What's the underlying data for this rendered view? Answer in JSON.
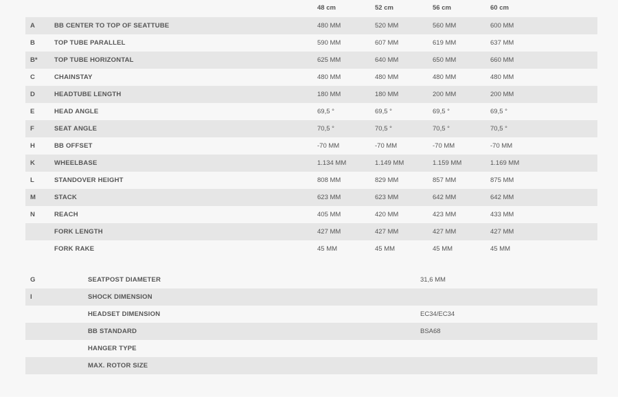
{
  "geometry": {
    "sizes": [
      "48 cm",
      "52 cm",
      "56 cm",
      "60 cm"
    ],
    "rows": [
      {
        "key": "A",
        "name": "BB CENTER TO TOP OF SEATTUBE",
        "values": [
          "480 MM",
          "520 MM",
          "560 MM",
          "600 MM"
        ]
      },
      {
        "key": "B",
        "name": "TOP TUBE PARALLEL",
        "values": [
          "590 MM",
          "607 MM",
          "619 MM",
          "637 MM"
        ]
      },
      {
        "key": "B*",
        "name": "TOP TUBE HORIZONTAL",
        "values": [
          "625 MM",
          "640 MM",
          "650 MM",
          "660 MM"
        ]
      },
      {
        "key": "C",
        "name": "CHAINSTAY",
        "values": [
          "480 MM",
          "480 MM",
          "480 MM",
          "480 MM"
        ]
      },
      {
        "key": "D",
        "name": "HEADTUBE LENGTH",
        "values": [
          "180 MM",
          "180 MM",
          "200 MM",
          "200 MM"
        ]
      },
      {
        "key": "E",
        "name": "HEAD ANGLE",
        "values": [
          "69,5 °",
          "69,5 °",
          "69,5 °",
          "69,5 °"
        ]
      },
      {
        "key": "F",
        "name": "SEAT ANGLE",
        "values": [
          "70,5 °",
          "70,5 °",
          "70,5 °",
          "70,5 °"
        ]
      },
      {
        "key": "H",
        "name": "BB OFFSET",
        "values": [
          "-70 MM",
          "-70 MM",
          "-70 MM",
          "-70 MM"
        ]
      },
      {
        "key": "K",
        "name": "WHEELBASE",
        "values": [
          "1.134 MM",
          "1.149 MM",
          "1.159 MM",
          "1.169 MM"
        ]
      },
      {
        "key": "L",
        "name": "STANDOVER HEIGHT",
        "values": [
          "808 MM",
          "829 MM",
          "857 MM",
          "875 MM"
        ]
      },
      {
        "key": "M",
        "name": "STACK",
        "values": [
          "623 MM",
          "623 MM",
          "642 MM",
          "642 MM"
        ]
      },
      {
        "key": "N",
        "name": "REACH",
        "values": [
          "405 MM",
          "420 MM",
          "423 MM",
          "433 MM"
        ]
      },
      {
        "key": "",
        "name": "FORK LENGTH",
        "values": [
          "427 MM",
          "427 MM",
          "427 MM",
          "427 MM"
        ]
      },
      {
        "key": "",
        "name": "FORK RAKE",
        "values": [
          "45 MM",
          "45 MM",
          "45 MM",
          "45 MM"
        ]
      }
    ]
  },
  "components": {
    "rows": [
      {
        "key": "G",
        "name": "SEATPOST DIAMETER",
        "value": "31,6 MM"
      },
      {
        "key": "I",
        "name": "SHOCK DIMENSION",
        "value": ""
      },
      {
        "key": "",
        "name": "HEADSET DIMENSION",
        "value": "EC34/EC34"
      },
      {
        "key": "",
        "name": "BB STANDARD",
        "value": "BSA68"
      },
      {
        "key": "",
        "name": "HANGER TYPE",
        "value": ""
      },
      {
        "key": "",
        "name": "MAX. ROTOR SIZE",
        "value": ""
      }
    ]
  }
}
